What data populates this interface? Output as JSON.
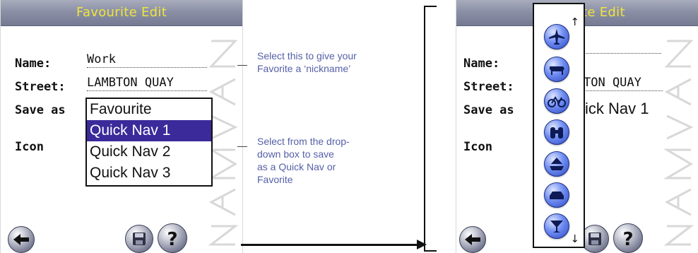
{
  "left_screen": {
    "title": "Favourite Edit",
    "fields": {
      "name_label": "Name:",
      "name_value": "Work",
      "street_label": "Street:",
      "street_value": "LAMBTON QUAY",
      "save_as_label": "Save as",
      "icon_label": "Icon"
    },
    "save_as_options": [
      "Favourite",
      "Quick Nav 1",
      "Quick Nav 2",
      "Quick Nav 3"
    ],
    "selected_option": "Quick Nav 1",
    "watermark": "NAVMAN"
  },
  "annotations": {
    "nickname_lines": [
      "Select this to give your",
      "Favorite a ‘nickname’"
    ],
    "dropdown_lines": [
      "Select from the drop-",
      "down box to save",
      "as a Quick Nav or",
      "Favorite"
    ]
  },
  "right_screen": {
    "title_part": "te Edit",
    "fields": {
      "name_label": "Name:",
      "street_label": "Street:",
      "street_value_part": "TON QUAY",
      "save_as_label": "Save as",
      "save_as_value_part": "ick Nav 1",
      "icon_label": "Icon"
    },
    "icon_options": [
      "airplane-icon",
      "cow-icon",
      "bicycle-icon",
      "binoculars-icon",
      "ship-icon",
      "car-icon",
      "cocktail-icon"
    ],
    "scroll_up": "↑",
    "scroll_down": "↓",
    "watermark": "NAVMAN"
  },
  "colors": {
    "title_text": "#f0e43d",
    "titlebar": "#8b90a6",
    "selected_option": "#3a2a9a",
    "annotation_text": "#5660a8",
    "icon_blue": "#2d49c2"
  }
}
